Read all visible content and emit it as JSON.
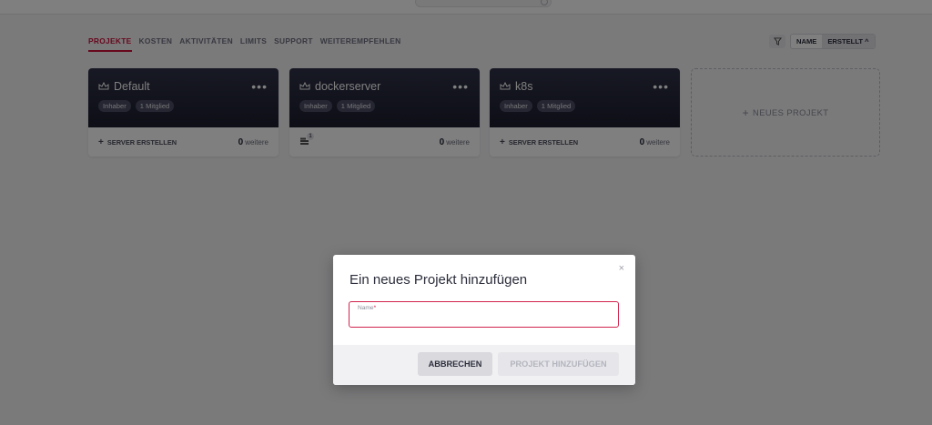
{
  "tabs": [
    {
      "label": "PROJEKTE",
      "active": true
    },
    {
      "label": "KOSTEN"
    },
    {
      "label": "AKTIVITÄTEN"
    },
    {
      "label": "LIMITS"
    },
    {
      "label": "SUPPORT"
    },
    {
      "label": "WEITEREMPFEHLEN"
    }
  ],
  "sort": {
    "name_label": "NAME",
    "created_label": "ERSTELLT ^"
  },
  "projects": [
    {
      "name": "Default",
      "role": "Inhaber",
      "members": "1 Mitglied",
      "action": "SERVER ERSTELLEN",
      "more_count": "0",
      "more_label": "weitere"
    },
    {
      "name": "dockerserver",
      "role": "Inhaber",
      "members": "1 Mitglied",
      "server_count": "1",
      "more_count": "0",
      "more_label": "weitere"
    },
    {
      "name": "k8s",
      "role": "Inhaber",
      "members": "1 Mitglied",
      "action": "SERVER ERSTELLEN",
      "more_count": "0",
      "more_label": "weitere"
    }
  ],
  "new_project": {
    "label": "NEUES PROJEKT"
  },
  "modal": {
    "title": "Ein neues Projekt hinzufügen",
    "close": "×",
    "field_label": "Name",
    "field_required": "*",
    "field_value": "",
    "cancel_label": "ABBRECHEN",
    "submit_label": "PROJEKT HINZUFÜGEN"
  },
  "colors": {
    "accent": "#d0103a",
    "card_header": "#1f2133"
  }
}
